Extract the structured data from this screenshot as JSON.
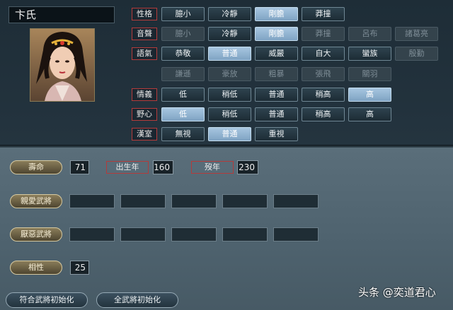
{
  "character": {
    "name": "卞氏"
  },
  "traits": [
    {
      "label": "性格",
      "options": [
        {
          "text": "臆小",
          "state": "normal"
        },
        {
          "text": "冷靜",
          "state": "normal"
        },
        {
          "text": "剛膽",
          "state": "sel"
        },
        {
          "text": "莽撞",
          "state": "normal"
        }
      ]
    },
    {
      "label": "音聲",
      "options": [
        {
          "text": "臆小",
          "state": "dis"
        },
        {
          "text": "冷靜",
          "state": "normal"
        },
        {
          "text": "剛膽",
          "state": "sel"
        },
        {
          "text": "莽撞",
          "state": "dis"
        },
        {
          "text": "呂布",
          "state": "dis"
        },
        {
          "text": "諸葛亮",
          "state": "dis"
        }
      ]
    },
    {
      "label": "語氣",
      "options": [
        {
          "text": "恭敬",
          "state": "normal"
        },
        {
          "text": "普通",
          "state": "sel"
        },
        {
          "text": "威嚴",
          "state": "normal"
        },
        {
          "text": "自大",
          "state": "normal"
        },
        {
          "text": "蠻族",
          "state": "normal"
        },
        {
          "text": "殷勤",
          "state": "dis"
        }
      ]
    },
    {
      "label": "",
      "options": [
        {
          "text": "謙遜",
          "state": "dis"
        },
        {
          "text": "豪放",
          "state": "dis"
        },
        {
          "text": "粗暴",
          "state": "dis"
        },
        {
          "text": "張飛",
          "state": "dis"
        },
        {
          "text": "關羽",
          "state": "dis"
        }
      ]
    },
    {
      "label": "情義",
      "options": [
        {
          "text": "低",
          "state": "normal"
        },
        {
          "text": "稍低",
          "state": "normal"
        },
        {
          "text": "普通",
          "state": "normal"
        },
        {
          "text": "稍高",
          "state": "normal"
        },
        {
          "text": "高",
          "state": "sel"
        }
      ]
    },
    {
      "label": "野心",
      "options": [
        {
          "text": "低",
          "state": "sel"
        },
        {
          "text": "稍低",
          "state": "normal"
        },
        {
          "text": "普通",
          "state": "normal"
        },
        {
          "text": "稍高",
          "state": "normal"
        },
        {
          "text": "高",
          "state": "normal"
        }
      ]
    },
    {
      "label": "漢室",
      "options": [
        {
          "text": "無視",
          "state": "normal"
        },
        {
          "text": "普通",
          "state": "sel"
        },
        {
          "text": "重視",
          "state": "normal"
        }
      ]
    }
  ],
  "lifespan": {
    "button": "壽命",
    "value": "71",
    "birth_label": "出生年",
    "birth_value": "160",
    "death_label": "歿年",
    "death_value": "230"
  },
  "favored": {
    "button": "親愛武將"
  },
  "disliked": {
    "button": "厭惡武將"
  },
  "compat": {
    "button": "相性",
    "value": "25"
  },
  "footer": {
    "reset_match": "符合武將初始化",
    "reset_all": "全武將初始化",
    "watermark": "头条 @奕道君心"
  }
}
